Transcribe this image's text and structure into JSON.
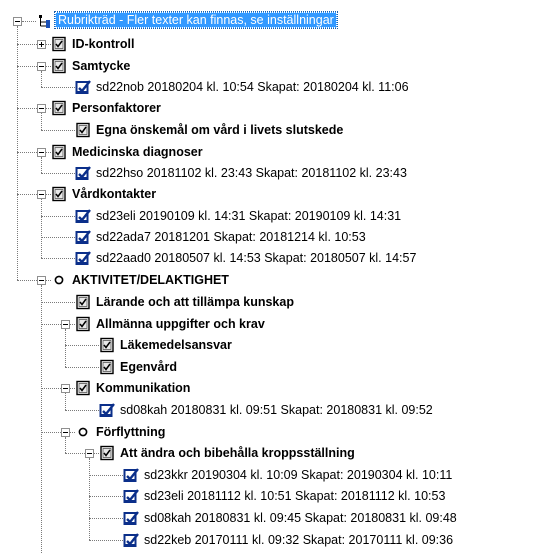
{
  "tree": {
    "root": {
      "label": "Rubrikträd - Fler texter kan finnas, se inställningar",
      "selected": true
    },
    "nodes": [
      {
        "label": "ID-kontroll",
        "bold": true,
        "icon": "checklist-icon",
        "expander": "plus"
      },
      {
        "label": "Samtycke",
        "bold": true,
        "icon": "checklist-icon",
        "expander": "minus"
      },
      {
        "label": "sd22nob 20180204  kl. 10:54  Skapat: 20180204 kl. 11:06",
        "bold": false,
        "icon": "signed-note-icon"
      },
      {
        "label": "Personfaktorer",
        "bold": true,
        "icon": "checklist-icon",
        "expander": "minus"
      },
      {
        "label": "Egna önskemål om vård i livets slutskede",
        "bold": true,
        "icon": "checklist-icon"
      },
      {
        "label": "Medicinska diagnoser",
        "bold": true,
        "icon": "checklist-icon",
        "expander": "minus"
      },
      {
        "label": "sd22hso 20181102  kl. 23:43  Skapat: 20181102 kl. 23:43",
        "bold": false,
        "icon": "signed-note-icon"
      },
      {
        "label": "Vårdkontakter",
        "bold": true,
        "icon": "checklist-icon",
        "expander": "minus"
      },
      {
        "label": "sd23eli 20190109  kl. 14:31  Skapat: 20190109 kl. 14:31",
        "bold": false,
        "icon": "signed-note-icon"
      },
      {
        "label": "sd22ada7 20181201  Skapat: 20181214 kl. 10:53",
        "bold": false,
        "icon": "signed-note-icon"
      },
      {
        "label": "sd22aad0 20180507  kl. 14:53  Skapat: 20180507 kl. 14:57",
        "bold": false,
        "icon": "signed-note-icon"
      },
      {
        "label": "AKTIVITET/DELAKTIGHET",
        "bold": true,
        "icon": "circle-icon",
        "expander": "minus"
      },
      {
        "label": "Lärande och att tillämpa kunskap",
        "bold": true,
        "icon": "checklist-icon"
      },
      {
        "label": "Allmänna uppgifter och krav",
        "bold": true,
        "icon": "checklist-icon",
        "expander": "minus"
      },
      {
        "label": "Läkemedelsansvar",
        "bold": true,
        "icon": "checklist-icon"
      },
      {
        "label": "Egenvård",
        "bold": true,
        "icon": "checklist-icon"
      },
      {
        "label": "Kommunikation",
        "bold": true,
        "icon": "checklist-icon",
        "expander": "minus"
      },
      {
        "label": "sd08kah 20180831  kl. 09:51  Skapat: 20180831 kl. 09:52",
        "bold": false,
        "icon": "signed-note-icon"
      },
      {
        "label": "Förflyttning",
        "bold": true,
        "icon": "circle-icon",
        "expander": "minus"
      },
      {
        "label": "Att ändra och bibehålla kroppsställning",
        "bold": true,
        "icon": "checklist-icon",
        "expander": "minus"
      },
      {
        "label": "sd23kkr 20190304  kl. 10:09  Skapat: 20190304 kl. 10:11",
        "bold": false,
        "icon": "signed-note-icon"
      },
      {
        "label": "sd23eli 20181112  kl. 10:51  Skapat: 20181112 kl. 10:53",
        "bold": false,
        "icon": "signed-note-icon"
      },
      {
        "label": "sd08kah 20180831  kl. 09:45  Skapat: 20180831 kl. 09:48",
        "bold": false,
        "icon": "signed-note-icon"
      },
      {
        "label": "sd22keb 20170111  kl. 09:32  Skapat: 20170111 kl. 09:36",
        "bold": false,
        "icon": "signed-note-icon"
      }
    ]
  }
}
